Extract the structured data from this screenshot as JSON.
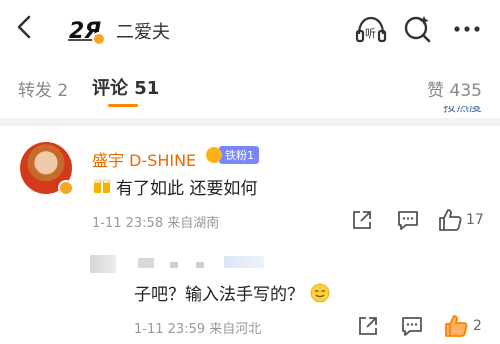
{
  "header": {
    "user_name": "二爱夫",
    "avatar_text": "2Я",
    "icons": [
      "back-icon",
      "listen-icon",
      "search-icon",
      "more-icon"
    ],
    "listen_label": "听"
  },
  "tabs": {
    "repost": "转发 2",
    "comment": "评论 51",
    "like": "赞 435",
    "sort_hint": "按热度"
  },
  "colors": {
    "accent": "#ff8200",
    "username": "#e86b00",
    "verified": "#f5a623",
    "like_active": "#ff8200"
  },
  "comment": {
    "user": "盛宇 D-SHINE",
    "fan_badge": "铁粉1",
    "text": "有了如此 还要如何",
    "emoji": "beer-icon",
    "meta": "1-11 23:58  来自湖南",
    "like_count": "17"
  },
  "reply": {
    "text": "子吧？输入法手写的？",
    "emoji": "smile-icon",
    "meta": "1-11 23:59  来自河北",
    "like_count": "2"
  }
}
